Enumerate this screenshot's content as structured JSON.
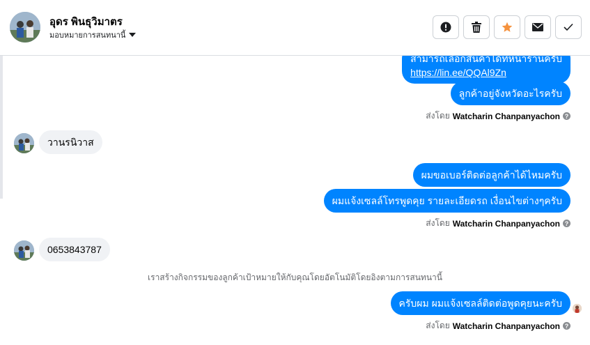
{
  "header": {
    "contact_name": "อุดร พินธุวิมาตร",
    "assign_label": "มอบหมายการสนทนานี้",
    "avatar_icon": "person-photo-icon"
  },
  "actions": [
    {
      "name": "report-button",
      "icon": "exclamation-circle-icon",
      "color": "#1c1e21"
    },
    {
      "name": "delete-button",
      "icon": "trash-icon",
      "color": "#1c1e21"
    },
    {
      "name": "star-button",
      "icon": "star-icon",
      "color": "#f5923e"
    },
    {
      "name": "mark-unread-button",
      "icon": "envelope-icon",
      "color": "#1c1e21"
    },
    {
      "name": "done-button",
      "icon": "check-icon",
      "color": "#1c1e21"
    }
  ],
  "messages": {
    "out_1_text": "สามารถเลือกสินค้าได้ที่หน้าร้านครับ",
    "out_1_link": "https://lin.ee/QQAl9Zn",
    "out_2": "ลูกค้าอยู่จังหวัดอะไรครับ",
    "sent_by_prefix": "ส่งโดย",
    "sender": "Watcharin Chanpanyachon",
    "in_1": "วานรนิวาส",
    "out_3": "ผมขอเบอร์ติดต่อลูกค้าได้ไหมครับ",
    "out_4": "ผมแจ้งเซลล์โทรพูดคุย รายละเอียดรถ เงื่อนไขต่างๆครับ",
    "in_2": "0653843787",
    "system_note": "เราสร้างกิจกรรมของลูกค้าเป้าหมายให้กับคุณโดยอัตโนมัติโดยอิงตามการสนทนานี้",
    "out_5": "ครับผม ผมแจ้งเซลล์ติดต่อพูดคุยนะครับ"
  },
  "colors": {
    "outgoing_bubble": "#0084ff",
    "incoming_bubble": "#f0f2f5",
    "star_accent": "#f5923e"
  }
}
